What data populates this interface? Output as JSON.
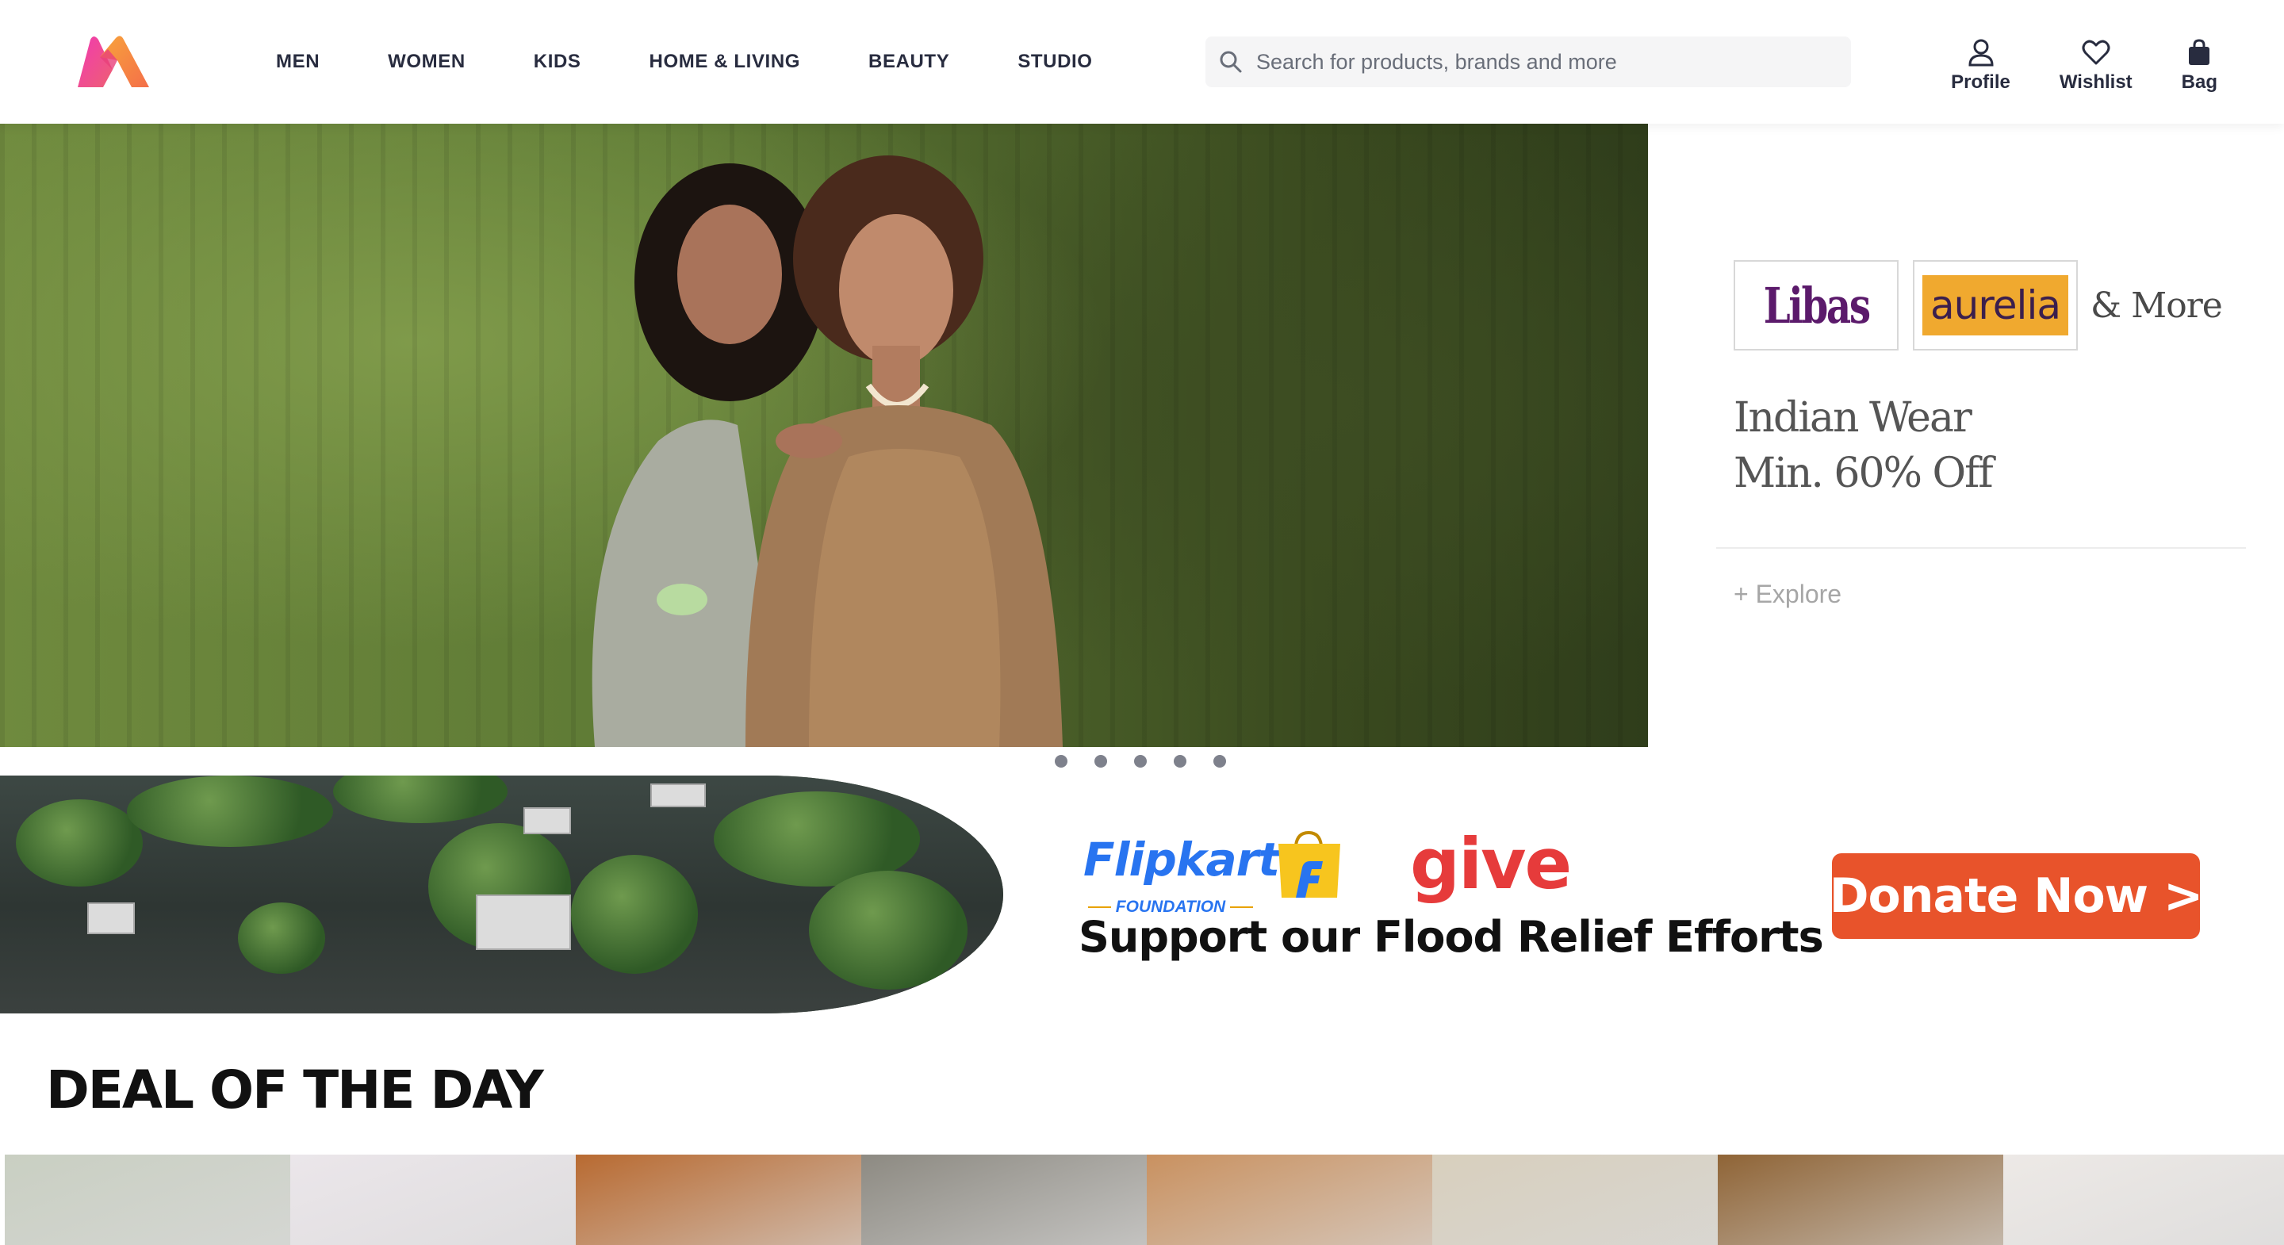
{
  "header": {
    "logo_name": "myntra-logo",
    "nav": [
      {
        "label": "MEN"
      },
      {
        "label": "WOMEN"
      },
      {
        "label": "KIDS"
      },
      {
        "label": "HOME & LIVING"
      },
      {
        "label": "BEAUTY"
      },
      {
        "label": "STUDIO"
      }
    ],
    "search": {
      "placeholder": "Search for products, brands and more",
      "value": ""
    },
    "actions": {
      "profile": "Profile",
      "wishlist": "Wishlist",
      "bag": "Bag"
    }
  },
  "hero": {
    "brands": {
      "libas": "Libas",
      "aurelia": "aurelia",
      "more": "& More"
    },
    "title_line1": "Indian Wear",
    "title_line2": "Min. 60% Off",
    "explore": "+ Explore",
    "slides": 5
  },
  "banner": {
    "flipkart": "Flipkart",
    "foundation": "FOUNDATION",
    "give": "give",
    "headline": "Support our Flood Relief Efforts",
    "cta": "Donate Now >"
  },
  "deals": {
    "title": "DEAL OF THE DAY",
    "cards": [
      {
        "bg": "#c9cfc2"
      },
      {
        "bg": "#ebe6ea"
      },
      {
        "bg": "#b86a31"
      },
      {
        "bg": "#8d8a82"
      },
      {
        "bg": "#c99160"
      },
      {
        "bg": "#d8cfbd"
      },
      {
        "bg": "#8f6436"
      },
      {
        "bg": "#ede9e6"
      }
    ]
  },
  "colors": {
    "accent": "#ff3f6c",
    "donate": "#e8532b",
    "flipkart_blue": "#2874f0",
    "give_red": "#e63b3b"
  }
}
